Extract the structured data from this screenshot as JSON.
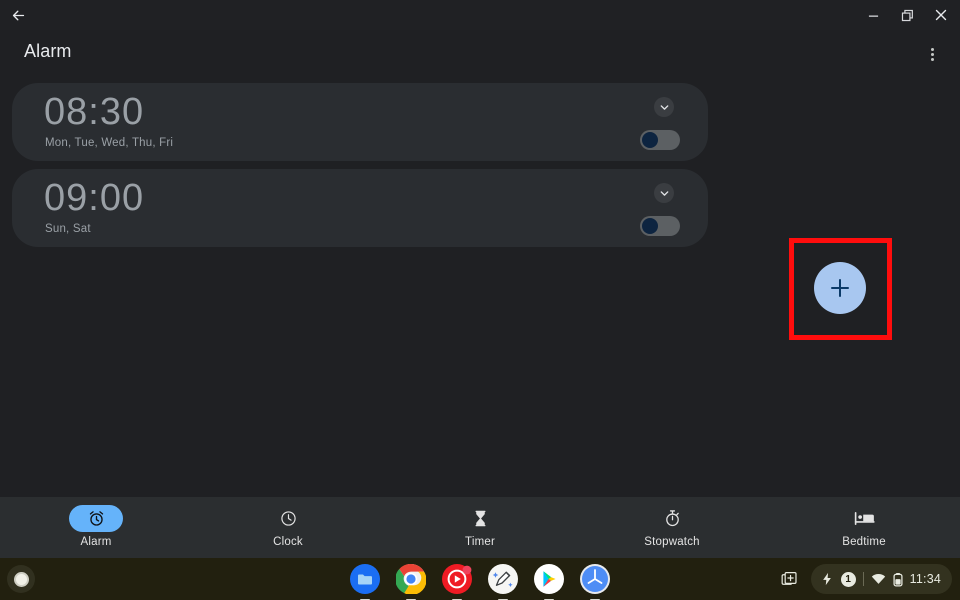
{
  "window": {
    "back_icon": "arrow-left-icon",
    "minimize_label": "Minimize",
    "restore_label": "Restore",
    "close_label": "Close"
  },
  "app": {
    "title": "Alarm",
    "overflow_label": "More options",
    "accent_color": "#a8c7f0",
    "nav_active_color": "#65b3fa",
    "highlight_color": "#ff0d0d",
    "card_color": "#2a2d31",
    "background_color": "#1f2023"
  },
  "alarms": [
    {
      "time": "08:30",
      "days": "Mon, Tue, Wed, Thu, Fri",
      "expand_icon": "chevron-down-icon",
      "enabled": false
    },
    {
      "time": "09:00",
      "days": "Sun, Sat",
      "expand_icon": "chevron-down-icon",
      "enabled": false
    }
  ],
  "fab": {
    "icon": "plus-icon",
    "label": "Add alarm"
  },
  "bottom_nav": {
    "items": [
      {
        "label": "Alarm",
        "icon": "alarm-clock-icon",
        "active": true
      },
      {
        "label": "Clock",
        "icon": "clock-icon",
        "active": false
      },
      {
        "label": "Timer",
        "icon": "hourglass-icon",
        "active": false
      },
      {
        "label": "Stopwatch",
        "icon": "stopwatch-icon",
        "active": false
      },
      {
        "label": "Bedtime",
        "icon": "bed-icon",
        "active": false
      }
    ]
  },
  "shelf": {
    "launcher_label": "Launcher",
    "apps": [
      {
        "name": "files-app-icon",
        "label": "Files"
      },
      {
        "name": "chrome-app-icon",
        "label": "Chrome"
      },
      {
        "name": "youtube-music-app-icon",
        "label": "YouTube Music"
      },
      {
        "name": "sketch-app-icon",
        "label": "Gallery"
      },
      {
        "name": "play-store-app-icon",
        "label": "Play Store"
      },
      {
        "name": "clock-app-icon",
        "label": "Clock"
      }
    ],
    "status": {
      "desk_icon": "new-desk-icon",
      "charging_icon": "bolt-icon",
      "notification_count": "1",
      "wifi_icon": "wifi-icon",
      "battery_icon": "battery-icon",
      "time": "11:34"
    }
  }
}
